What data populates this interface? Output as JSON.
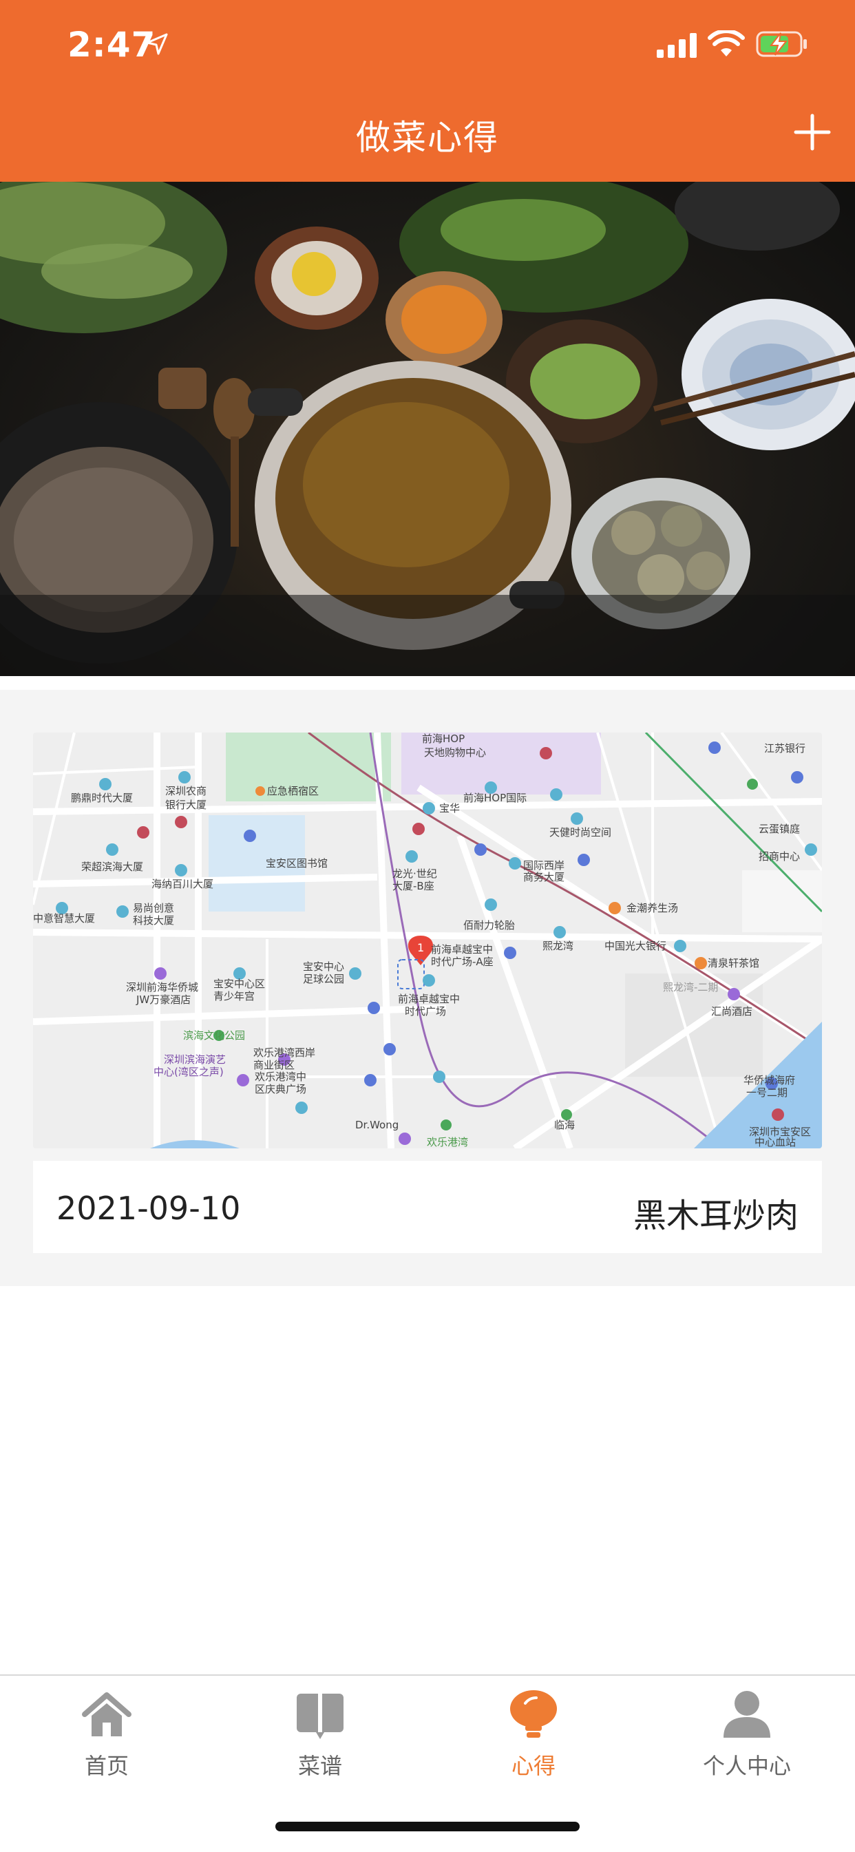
{
  "status_bar": {
    "time": "2:47"
  },
  "header": {
    "title": "做菜心得",
    "add_icon": "plus-icon"
  },
  "hero": {
    "image": "cooking-ingredients-photo"
  },
  "card": {
    "date": "2021-09-10",
    "title": "黑木耳炒肉",
    "map": {
      "marker_number": "1",
      "labels": [
        "前海HOP",
        "天地购物中心",
        "江苏银行",
        "深圳农商",
        "银行大厦",
        "鹏鼎时代大厦",
        "应急栖宿区",
        "宝华",
        "前海HOP国际",
        "天健时尚空间",
        "云蛋镇庭",
        "招商中心",
        "荣超滨海大厦",
        "宝安区图书馆",
        "国际西岸",
        "商务大厦",
        "海纳百川大厦",
        "龙光·世纪",
        "大厦-B座",
        "金潮养生汤",
        "中意智慧大厦",
        "易尚创意",
        "科技大厦",
        "佰耐力轮胎",
        "熙龙湾",
        "中国光大银行",
        "清泉轩茶馆",
        "深圳前海华侨城",
        "JW万豪酒店",
        "宝安中心区",
        "青少年宫",
        "宝安中心",
        "足球公园",
        "前海卓越宝中",
        "时代广场-A座",
        "前海卓越宝中",
        "时代广场",
        "熙龙湾-二期",
        "汇尚酒店",
        "滨海文化公园",
        "深圳滨海演艺",
        "中心(湾区之声)",
        "欢乐港湾西岸",
        "商业街区",
        "华侨城海府",
        "一号二期",
        "临海",
        "深圳市宝安区",
        "中心血站",
        "欢乐港湾中",
        "区庆典广场",
        "Dr.Wong",
        "欢乐港湾"
      ]
    }
  },
  "tabbar": {
    "tabs": [
      {
        "label": "首页",
        "icon": "home-icon"
      },
      {
        "label": "菜谱",
        "icon": "recipe-book-icon"
      },
      {
        "label": "心得",
        "icon": "lightbulb-icon"
      },
      {
        "label": "个人中心",
        "icon": "user-icon"
      }
    ],
    "active_index": 2
  },
  "colors": {
    "accent": "#ee6b2e",
    "tab_active": "#ee7c33",
    "background": "#f4f4f4"
  }
}
